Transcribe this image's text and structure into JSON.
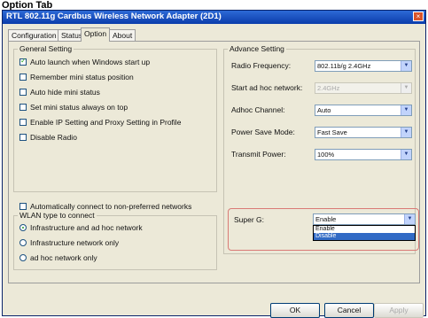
{
  "caption": "Option Tab",
  "window": {
    "title": "RTL 802.11g Cardbus Wireless Network Adapter (2D1)",
    "close_symbol": "×"
  },
  "tabs": [
    {
      "label": "Configuration"
    },
    {
      "label": "Status"
    },
    {
      "label": "Option"
    },
    {
      "label": "About"
    }
  ],
  "active_tab": "Option",
  "general": {
    "title": "General Setting",
    "items": [
      {
        "label": "Auto launch when Windows start up",
        "checked": true
      },
      {
        "label": "Remember mini status position",
        "checked": false
      },
      {
        "label": "Auto hide mini status",
        "checked": false
      },
      {
        "label": "Set mini status always on top",
        "checked": false
      },
      {
        "label": "Enable IP Setting and Proxy Setting in Profile",
        "checked": false
      },
      {
        "label": "Disable Radio",
        "checked": false
      }
    ]
  },
  "network": {
    "auto_connect_label": "Automatically connect to non-preferred networks",
    "auto_connect_checked": false,
    "type_title": "WLAN type to connect",
    "types": [
      {
        "label": "Infrastructure and ad hoc network",
        "checked": true
      },
      {
        "label": "Infrastructure network only",
        "checked": false
      },
      {
        "label": "ad hoc network only",
        "checked": false
      }
    ]
  },
  "advanced": {
    "title": "Advance Setting",
    "fields": [
      {
        "label": "Radio Frequency:",
        "value": "802.11b/g 2.4GHz",
        "disabled": false
      },
      {
        "label": "Start ad hoc network:",
        "value": "2.4GHz",
        "disabled": true
      },
      {
        "label": "Adhoc Channel:",
        "value": "Auto",
        "disabled": false
      },
      {
        "label": "Power Save Mode:",
        "value": "Fast Save",
        "disabled": false
      },
      {
        "label": "Transmit Power:",
        "value": "100%",
        "disabled": false
      },
      {
        "label": "Super G:",
        "value": "Enable",
        "disabled": false
      }
    ],
    "super_g_options": [
      {
        "label": "Enable",
        "selected": false
      },
      {
        "label": "Disable",
        "selected": true
      }
    ]
  },
  "buttons": {
    "ok": "OK",
    "cancel": "Cancel",
    "apply": "Apply"
  }
}
